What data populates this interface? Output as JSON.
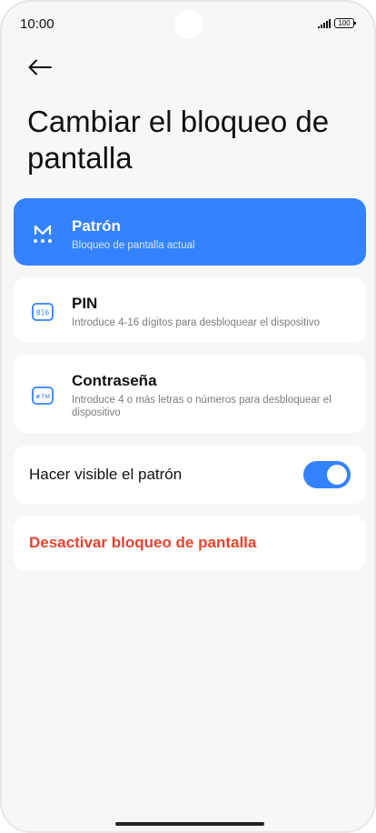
{
  "status_bar": {
    "time": "10:00",
    "battery": "100"
  },
  "header": {
    "back_icon": "arrow-left-icon",
    "title": "Cambiar el bloqueo de pantalla"
  },
  "options": [
    {
      "icon": "pattern-icon",
      "title": "Patrón",
      "description": "Bloqueo de pantalla actual",
      "selected": true
    },
    {
      "icon": "pin-icon",
      "icon_text": "816",
      "title": "PIN",
      "description": "Introduce 4-16 dígitos para desbloquear el dispositivo",
      "selected": false
    },
    {
      "icon": "password-icon",
      "icon_text": "#7M",
      "title": "Contraseña",
      "description": "Introduce 4 o más letras o números para desbloquear el dispositivo",
      "selected": false
    }
  ],
  "visible_pattern": {
    "label": "Hacer visible el patrón",
    "enabled": true
  },
  "disable_lock": {
    "label": "Desactivar bloqueo de pantalla"
  },
  "colors": {
    "accent": "#3482ff",
    "danger": "#e5442f",
    "background": "#f7f7f7"
  }
}
